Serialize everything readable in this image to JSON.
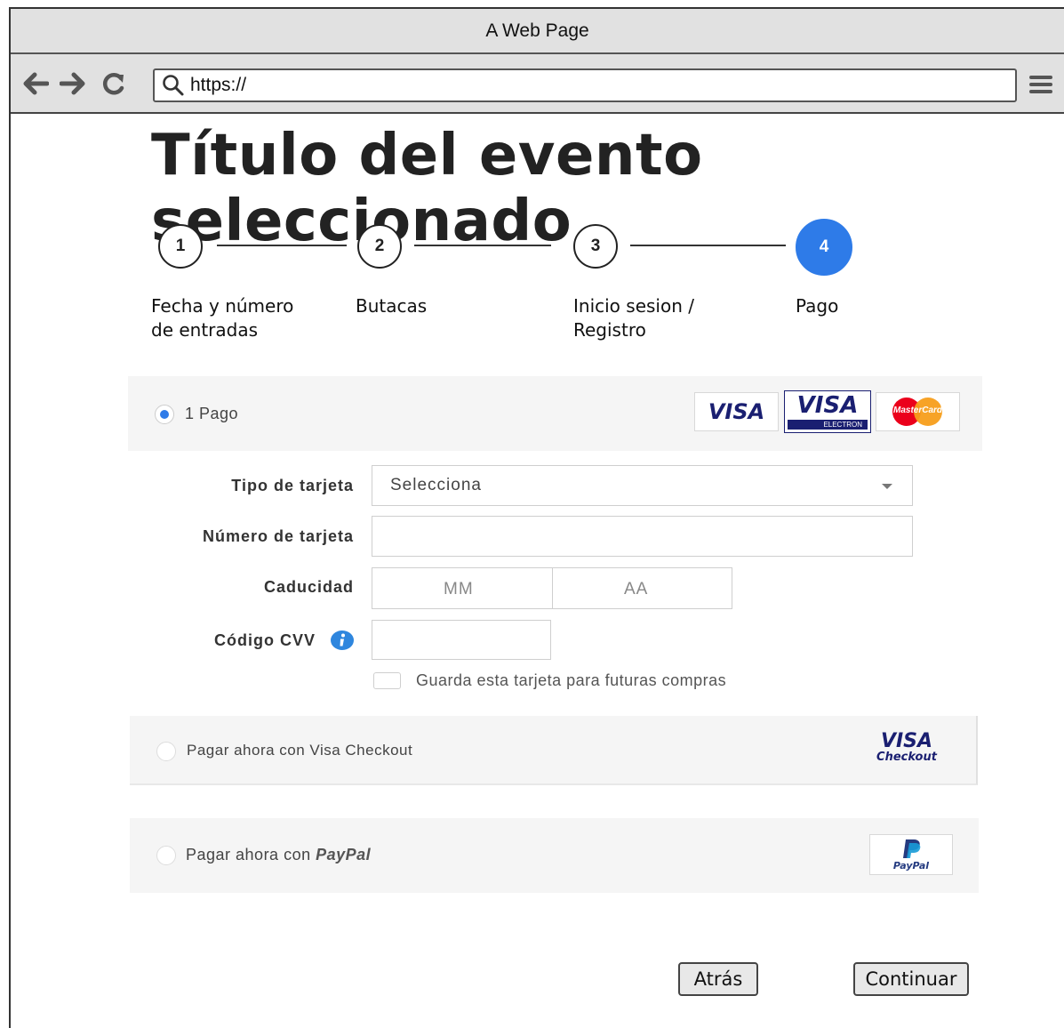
{
  "window": {
    "title": "A Web Page"
  },
  "browser": {
    "url": "https://"
  },
  "page": {
    "title": "Título del evento seleccionado"
  },
  "steps": [
    {
      "number": "1",
      "label_line1": "Fecha y número",
      "label_line2": "de entradas"
    },
    {
      "number": "2",
      "label_line1": "Butacas",
      "label_line2": ""
    },
    {
      "number": "3",
      "label_line1": "Inicio sesion /",
      "label_line2": "Registro"
    },
    {
      "number": "4",
      "label_line1": "Pago",
      "label_line2": "",
      "active": true
    }
  ],
  "payment": {
    "option1_label": "1 Pago",
    "card_logos": {
      "visa": "VISA",
      "visa_electron": "VISA",
      "visa_electron_sub": "ELECTRON",
      "mastercard": "MasterCard"
    },
    "form": {
      "card_type_label": "Tipo de tarjeta",
      "card_type_value": "Selecciona",
      "card_number_label": "Número de tarjeta",
      "card_number_value": "",
      "expiry_label": "Caducidad",
      "expiry_month_placeholder": "MM",
      "expiry_year_placeholder": "AA",
      "cvv_label": "Código CVV",
      "cvv_value": "",
      "save_card_label": "Guarda esta tarjeta para futuras compras",
      "save_card_checked": false
    },
    "option2_label": "Pagar ahora con Visa Checkout",
    "visa_checkout_logo": {
      "top": "VISA",
      "bottom": "Checkout"
    },
    "option3_prefix": "Pagar ahora con ",
    "option3_brand": "PayPal",
    "paypal_logo_text": "PayPal"
  },
  "buttons": {
    "back": "Atrás",
    "continue": "Continuar"
  },
  "colors": {
    "accent": "#2e7be8",
    "visa_blue": "#1a1f71",
    "paypal_dark": "#253b80",
    "paypal_light": "#179bd7"
  }
}
